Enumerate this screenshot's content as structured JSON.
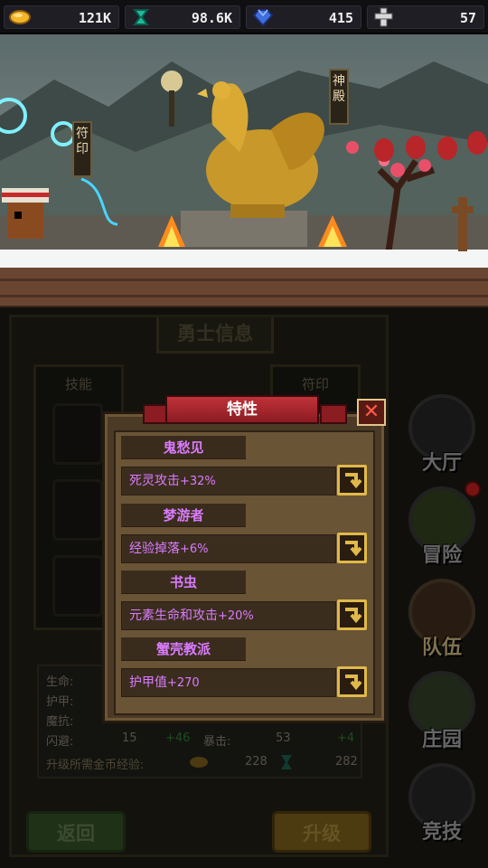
{
  "resources": [
    {
      "icon": "gold-coin-icon",
      "value": "121K"
    },
    {
      "icon": "energy-crystal-icon",
      "value": "98.6K"
    },
    {
      "icon": "blue-gem-icon",
      "value": "415"
    },
    {
      "icon": "cross-token-icon",
      "value": "57"
    }
  ],
  "scene": {
    "sign_left": "符印",
    "sign_right": "神殿"
  },
  "panel": {
    "title": "勇士信息",
    "skills_label": "技能",
    "runes_label": "符印",
    "stats": {
      "hp_label": "生命:",
      "armor_label": "护甲:",
      "resist_label": "魔抗:",
      "dodge_label": "闪避:",
      "dodge_value": "15",
      "dodge_bonus": "+46",
      "crit_label": "暴击:",
      "crit_value": "53",
      "crit_bonus": "+4",
      "upgrade_cost_label": "升级所需金币经验:",
      "gold_cost": "228",
      "exp_cost": "282"
    },
    "back_button": "返回",
    "upgrade_button": "升级"
  },
  "nav": [
    {
      "label": "大厅",
      "icon": "hall-icon"
    },
    {
      "label": "冒险",
      "icon": "adventure-icon"
    },
    {
      "label": "队伍",
      "icon": "team-icon"
    },
    {
      "label": "庄园",
      "icon": "manor-icon"
    },
    {
      "label": "竞技",
      "icon": "arena-icon"
    }
  ],
  "modal": {
    "title": "特性",
    "close": "✕",
    "traits": [
      {
        "name": "鬼愁见",
        "effect": "死灵攻击",
        "bonus": "+32%"
      },
      {
        "name": "梦游者",
        "effect": "经验掉落",
        "bonus": "+6%"
      },
      {
        "name": "书虫",
        "effect": "元素生命和攻击",
        "bonus": "+20%"
      },
      {
        "name": "蟹壳教派",
        "effect": "护甲值",
        "bonus": "+270"
      }
    ]
  },
  "colors": {
    "trait_text": "#d97bff",
    "ribbon_red": "#c03238",
    "gold_border": "#e0b94a"
  }
}
